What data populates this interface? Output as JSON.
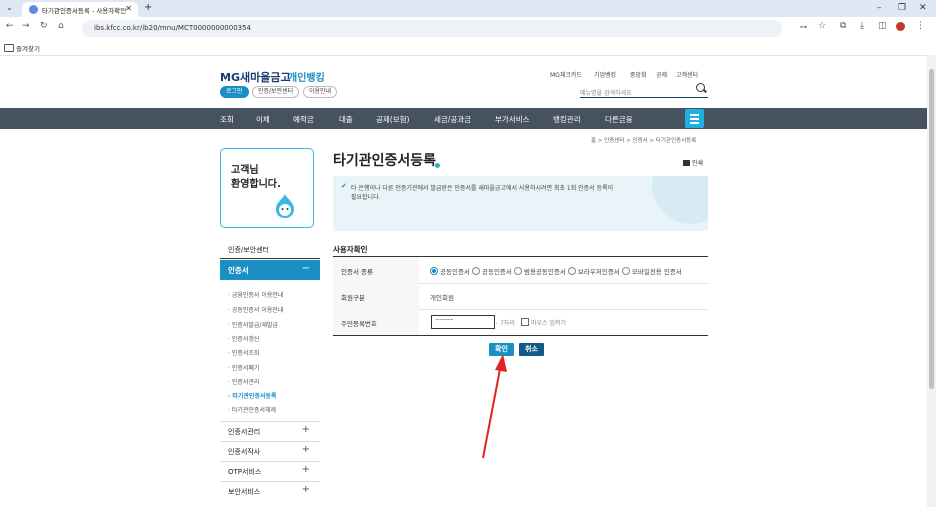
{
  "browser": {
    "tab_title": "타기관인증서등록 - 사용자확인",
    "tab_close": "✕",
    "new_tab": "+",
    "url": "ibs.kfcc.co.kr/ib20/mnu/MCT0000000000354",
    "bookmarks_label": "즐겨찾기",
    "window_controls": [
      "–",
      "❐",
      "✕"
    ]
  },
  "header": {
    "logo": "MG새마을금고",
    "service": "개인뱅킹",
    "login": "로그인",
    "cert_center_pill": "인증/보안센터",
    "guide_pill": "이용안내",
    "top_links": [
      "MG체크카드",
      "기업뱅킹",
      "공제",
      "중앙회",
      "고객센터"
    ],
    "search_placeholder": "메뉴명을 검색하세요"
  },
  "nav": {
    "items": [
      "조회",
      "이체",
      "예적금",
      "대출",
      "공제(보험)",
      "세금/공과금",
      "부가서비스",
      "뱅킹관리",
      "다른금융"
    ]
  },
  "breadcrumb": "홈 > 인증센터 > 인증서 > 타기관인증서등록",
  "sidebar": {
    "welcome_line1": "고객님",
    "welcome_line2": "환영합니다.",
    "section_title": "인증/보안센터",
    "active_group": "인증서",
    "active_symbol": "−",
    "sub_items": [
      "금융인증서 이용안내",
      "공동인증서 이용안내",
      "인증서발급/재발급",
      "인증서갱신",
      "인증서조회",
      "인증서폐기",
      "인증서관리",
      "타기관인증서등록",
      "타기관인증서해제"
    ],
    "active_sub_index": 7,
    "groups": [
      "인증서관리",
      "인증서작사",
      "OTP서비스",
      "보안서비스"
    ],
    "group_symbol": "+"
  },
  "main": {
    "title": "타기관인증서등록",
    "print": "인쇄",
    "notice_line1": "타 은행이나 다른 인증기관에서 발급받은 인증서를 새마을금고에서 사용하시려면 최초 1회 인증서 등록이",
    "notice_line2": "필요합니다.",
    "section_title": "사용자확인",
    "rows": [
      {
        "label": "인증서 종류",
        "options": [
          "공동인증서",
          "공동인증서",
          "범용공동인증서",
          "브라우저인증서",
          "모바일전용 인증서"
        ],
        "selected": 0
      },
      {
        "label": "회원구분",
        "value": "개인회원"
      },
      {
        "label": "주민등록번호",
        "value": "·············",
        "hint": "- 7자리",
        "checkbox_label": "마우스 입력기"
      }
    ],
    "confirm_button": "확인",
    "cancel_button": "취소"
  },
  "colors": {
    "accent": "#1a8fc4",
    "nav_bg": "#46525e",
    "arrow": "#e02424"
  }
}
